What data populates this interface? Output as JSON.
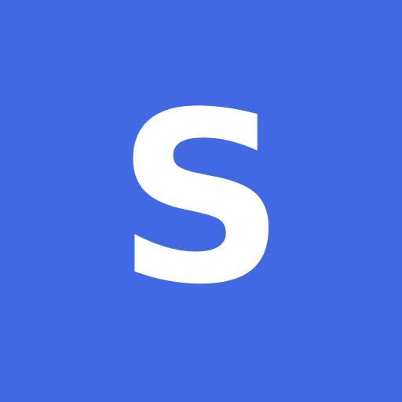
{
  "tile": {
    "letter": "S",
    "background_color": "#4169E1",
    "text_color": "#FFFFFF"
  }
}
